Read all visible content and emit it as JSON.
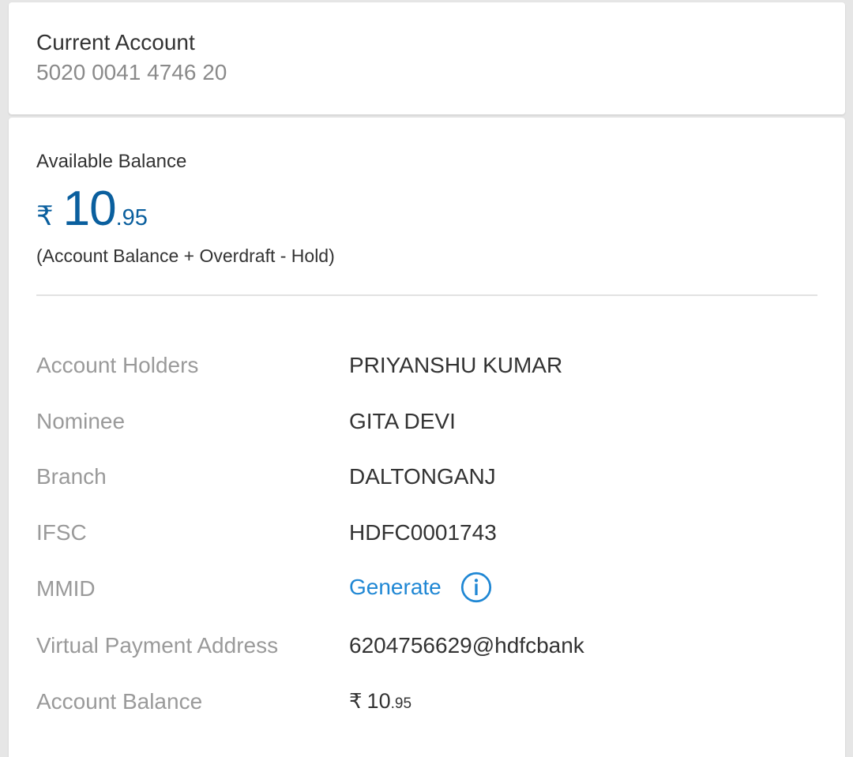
{
  "account": {
    "type": "Current Account",
    "number": "5020 0041 4746 20"
  },
  "balance": {
    "label": "Available Balance",
    "currency": "₹",
    "integer": "10",
    "decimal": ".95",
    "formula": "(Account Balance + Overdraft - Hold)"
  },
  "details": {
    "holders": {
      "label": "Account Holders",
      "value": "PRIYANSHU KUMAR"
    },
    "nominee": {
      "label": "Nominee",
      "value": "GITA DEVI"
    },
    "branch": {
      "label": "Branch",
      "value": "DALTONGANJ"
    },
    "ifsc": {
      "label": "IFSC",
      "value": "HDFC0001743"
    },
    "mmid": {
      "label": "MMID",
      "action": "Generate",
      "icon": "info-icon"
    },
    "vpa": {
      "label": "Virtual Payment Address",
      "value": "6204756629@hdfcbank"
    },
    "account_balance": {
      "label": "Account Balance",
      "currency": "₹",
      "integer": "10",
      "decimal": ".95"
    }
  },
  "colors": {
    "accent": "#0a5f9e",
    "link": "#1f87d4",
    "label_gray": "#9a9a9a",
    "text": "#333333"
  }
}
